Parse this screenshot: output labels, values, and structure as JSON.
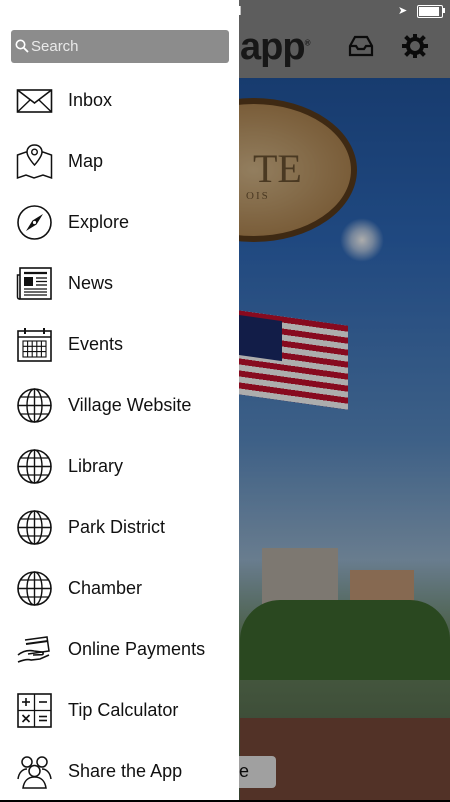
{
  "status_bar": {
    "time": "PM"
  },
  "header": {
    "logo_text": "app",
    "logo_mark": "®",
    "inbox_icon": "inbox-tray-icon",
    "settings_icon": "gear-icon"
  },
  "background": {
    "sign_text": "TE",
    "sign_subtext": "OIS"
  },
  "search": {
    "placeholder": "Search",
    "value": ""
  },
  "menu": {
    "items": [
      {
        "label": "Inbox",
        "icon": "envelope-icon"
      },
      {
        "label": "Map",
        "icon": "map-pin-icon"
      },
      {
        "label": "Explore",
        "icon": "compass-icon"
      },
      {
        "label": "News",
        "icon": "newspaper-icon"
      },
      {
        "label": "Events",
        "icon": "calendar-icon"
      },
      {
        "label": "Village Website",
        "icon": "globe-icon"
      },
      {
        "label": "Library",
        "icon": "globe-icon"
      },
      {
        "label": "Park District",
        "icon": "globe-icon"
      },
      {
        "label": "Chamber",
        "icon": "globe-icon"
      },
      {
        "label": "Online Payments",
        "icon": "payment-hand-icon"
      },
      {
        "label": "Tip Calculator",
        "icon": "calculator-icon"
      },
      {
        "label": "Share the App",
        "icon": "people-icon"
      }
    ]
  },
  "bottom_button": {
    "label": "e"
  }
}
